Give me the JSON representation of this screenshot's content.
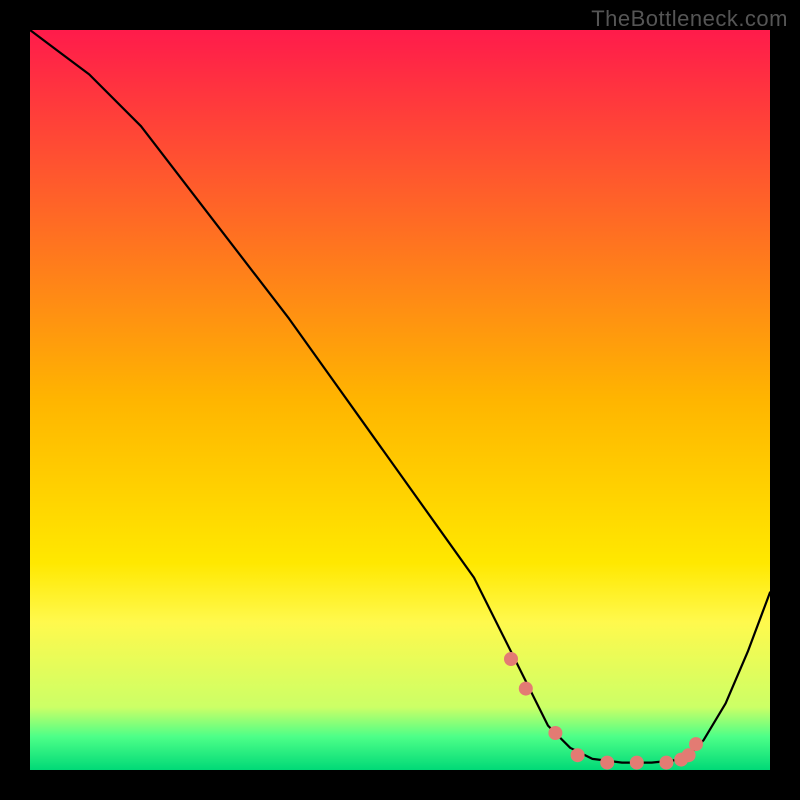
{
  "watermark": "TheBottleneck.com",
  "chart_data": {
    "type": "line",
    "title": "",
    "xlabel": "",
    "ylabel": "",
    "xlim": [
      0,
      100
    ],
    "ylim": [
      0,
      100
    ],
    "grid": false,
    "legend": false,
    "background_gradient_stops": [
      {
        "pos": 0.0,
        "color": "#ff1b4b"
      },
      {
        "pos": 0.5,
        "color": "#ffb500"
      },
      {
        "pos": 0.72,
        "color": "#ffe800"
      },
      {
        "pos": 0.8,
        "color": "#fff94d"
      },
      {
        "pos": 0.915,
        "color": "#ccff66"
      },
      {
        "pos": 0.955,
        "color": "#4dff88"
      },
      {
        "pos": 1.0,
        "color": "#00d977"
      }
    ],
    "series": [
      {
        "name": "bottleneck-curve",
        "color": "#000000",
        "stroke_width": 2.2,
        "x": [
          0,
          4,
          8,
          15,
          25,
          35,
          45,
          55,
          60,
          64,
          66,
          68,
          70,
          73,
          76,
          80,
          84,
          87,
          89,
          91,
          94,
          97,
          100
        ],
        "y": [
          100,
          97,
          94,
          87,
          74,
          61,
          47,
          33,
          26,
          18,
          14,
          10,
          6,
          3,
          1.5,
          1,
          1,
          1.3,
          2,
          4,
          9,
          16,
          24
        ]
      },
      {
        "name": "highlight-markers",
        "color": "#e37b73",
        "marker_radius": 7,
        "x": [
          65,
          67,
          71,
          74,
          78,
          82,
          86,
          88,
          89,
          90
        ],
        "y": [
          15,
          11,
          5,
          2,
          1,
          1,
          1,
          1.4,
          2,
          3.5
        ]
      }
    ]
  }
}
